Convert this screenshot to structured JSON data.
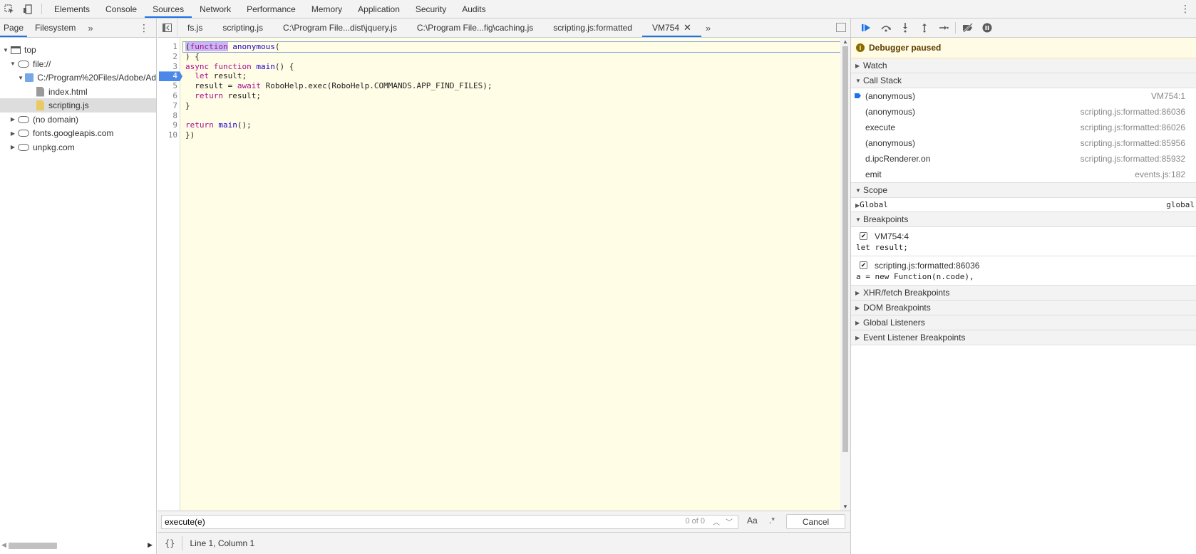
{
  "toolbar": {
    "tabs": [
      "Elements",
      "Console",
      "Sources",
      "Network",
      "Performance",
      "Memory",
      "Application",
      "Security",
      "Audits"
    ],
    "active_tab": "Sources"
  },
  "navigator": {
    "tabs": [
      "Page",
      "Filesystem"
    ],
    "tree": [
      {
        "label": "top",
        "icon": "frame-icon",
        "expanded": true
      },
      {
        "label": "file://",
        "icon": "cloud-icon",
        "expanded": true
      },
      {
        "label": "C:/Program%20Files/Adobe/Ad",
        "icon": "folder-icon",
        "expanded": true
      },
      {
        "label": "index.html",
        "icon": "file-icon"
      },
      {
        "label": "scripting.js",
        "icon": "js-file-icon",
        "selected": true
      },
      {
        "label": "(no domain)",
        "icon": "cloud-icon",
        "expanded": false
      },
      {
        "label": "fonts.googleapis.com",
        "icon": "cloud-icon",
        "expanded": false
      },
      {
        "label": "unpkg.com",
        "icon": "cloud-icon",
        "expanded": false
      }
    ]
  },
  "editor": {
    "file_tabs": [
      "fs.js",
      "scripting.js",
      "C:\\Program File...dist\\jquery.js",
      "C:\\Program File...fig\\caching.js",
      "scripting.js:formatted",
      "VM754"
    ],
    "active_file_tab": "VM754",
    "line_numbers": [
      "1",
      "2",
      "3",
      "4",
      "5",
      "6",
      "7",
      "8",
      "9",
      "10"
    ],
    "breakpoint_line": "4",
    "code_lines": [
      "(function anonymous(",
      ") {",
      "async function main() {",
      "  let result;",
      "  result = await RoboHelp.exec(RoboHelp.COMMANDS.APP_FIND_FILES);",
      "  return result;",
      "}",
      "",
      "return main();",
      "})"
    ],
    "search": {
      "value": "execute(e)",
      "count": "0 of 0",
      "match_case_label": "Aa",
      "regex_label": ".*",
      "cancel_label": "Cancel"
    },
    "status": {
      "pretty_print": "{}",
      "cursor": "Line 1, Column 1"
    }
  },
  "debugger": {
    "paused_label": "Debugger paused",
    "sections": {
      "watch": "Watch",
      "call_stack": "Call Stack",
      "scope": "Scope",
      "breakpoints": "Breakpoints",
      "xhr": "XHR/fetch Breakpoints",
      "dom": "DOM Breakpoints",
      "global_listeners": "Global Listeners",
      "event_listeners": "Event Listener Breakpoints"
    },
    "call_stack": [
      {
        "name": "(anonymous)",
        "location": "VM754:1",
        "current": true
      },
      {
        "name": "(anonymous)",
        "location": "scripting.js:formatted:86036"
      },
      {
        "name": "execute",
        "location": "scripting.js:formatted:86026"
      },
      {
        "name": "(anonymous)",
        "location": "scripting.js:formatted:85956"
      },
      {
        "name": "d.ipcRenderer.on",
        "location": "scripting.js:formatted:85932"
      },
      {
        "name": "emit",
        "location": "events.js:182"
      }
    ],
    "scope": [
      {
        "name": "Global",
        "value": "global"
      }
    ],
    "breakpoints": [
      {
        "location": "VM754:4",
        "code": "let result;",
        "checked": true
      },
      {
        "location": "scripting.js:formatted:86036",
        "code": "a = new Function(n.code),",
        "checked": true
      }
    ]
  }
}
